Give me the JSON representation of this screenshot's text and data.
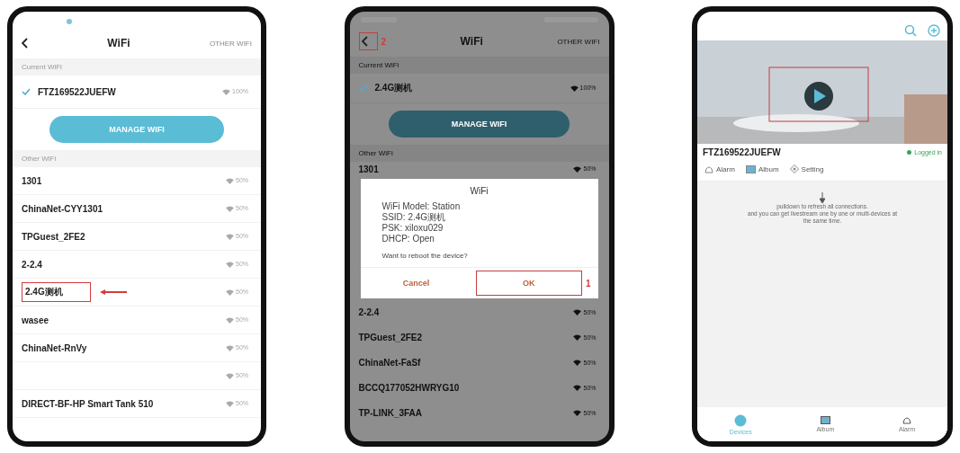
{
  "wifi_screen": {
    "title": "WiFi",
    "other_link": "OTHER WIFI",
    "current_label": "Current WiFi",
    "current": {
      "name": "FTZ169522JUEFW",
      "signal": "100%",
      "checked": true
    },
    "manage_button": "MANAGE WIFI",
    "other_label": "Other WiFi",
    "networks": [
      {
        "name": "1301",
        "signal": "50%",
        "highlighted": false
      },
      {
        "name": "ChinaNet-CYY1301",
        "signal": "50%",
        "highlighted": false
      },
      {
        "name": "TPGuest_2FE2",
        "signal": "50%",
        "highlighted": false
      },
      {
        "name": "2-2.4",
        "signal": "50%",
        "highlighted": false
      },
      {
        "name": "2.4G测机",
        "signal": "50%",
        "highlighted": true
      },
      {
        "name": "wasee",
        "signal": "50%",
        "highlighted": false
      },
      {
        "name": "ChinaNet-RnVy",
        "signal": "50%",
        "highlighted": false
      },
      {
        "signal": "50%",
        "highlighted": false
      },
      {
        "name": "DIRECT-BF-HP Smart Tank 510",
        "signal": "50%",
        "highlighted": false
      }
    ]
  },
  "reboot_screen": {
    "title": "WiFi",
    "other_link": "OTHER WIFI",
    "back_marker": "2",
    "current_label": "Current WiFi",
    "current": {
      "name": "2.4G测机",
      "signal": "100%",
      "checked": true
    },
    "manage_button": "MANAGE WIFI",
    "other_label": "Other WiFi",
    "networks_above": [
      {
        "name": "1301",
        "signal": "50%"
      }
    ],
    "dialog": {
      "title": "WiFi",
      "lines": [
        "WiFi Model: Station",
        "SSID: 2.4G测机",
        "PSK: xiloxu029",
        "DHCP: Open"
      ],
      "question": "Want to reboot the device?",
      "buttons": [
        {
          "label": "Cancel",
          "highlighted": false
        },
        {
          "label": "OK",
          "highlighted": true
        }
      ],
      "ok_marker": "1"
    },
    "networks_below": [
      {
        "name": "2-2.4",
        "signal": "50%"
      },
      {
        "name": "TPGuest_2FE2",
        "signal": "50%"
      },
      {
        "name": "ChinaNet-FaSf",
        "signal": "50%"
      },
      {
        "name": "BCCQ177052HWRYG10",
        "signal": "50%"
      },
      {
        "name": "TP-LINK_3FAA",
        "signal": "50%"
      }
    ]
  },
  "device_screen": {
    "device": {
      "name": "FTZ169522JUEFW",
      "status": "Logged in",
      "online": true
    },
    "actions": [
      {
        "kind": "alarm",
        "label": "Alarm"
      },
      {
        "kind": "album",
        "label": "Album"
      },
      {
        "kind": "setting",
        "label": "Setting"
      }
    ],
    "hint_lines": [
      "pulldown to refresh all connections.",
      "and you can get livestream one by one or multi-devices at",
      "the same time."
    ],
    "tabs": [
      {
        "kind": "devices",
        "label": "Devices",
        "selected": true
      },
      {
        "kind": "album",
        "label": "Album",
        "selected": false
      },
      {
        "kind": "alarm",
        "label": "Alarm",
        "selected": false
      }
    ]
  }
}
